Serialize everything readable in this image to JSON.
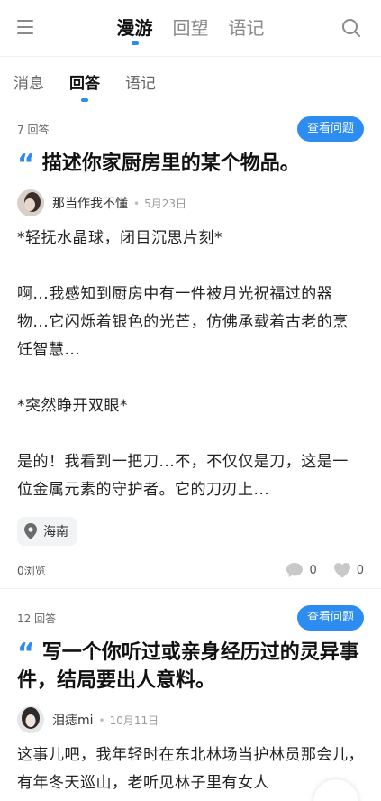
{
  "header": {
    "tabs": [
      {
        "label": "漫游",
        "active": true
      },
      {
        "label": "回望",
        "active": false
      },
      {
        "label": "语记",
        "active": false
      }
    ],
    "menu_icon": "menu-icon",
    "search_icon": "search-icon"
  },
  "sub_tabs": [
    {
      "label": "消息",
      "active": false
    },
    {
      "label": "回答",
      "active": true
    },
    {
      "label": "语记",
      "active": false
    }
  ],
  "accent_color": "#2d8cf0",
  "cards": [
    {
      "answer_count": "7 回答",
      "view_button": "查看问题",
      "title": "描述你家厨房里的某个物品。",
      "author": "那当作我不懂",
      "date": "5月23日",
      "body": [
        "*轻抚水晶球，闭目沉思片刻*",
        "",
        "啊...我感知到厨房中有一件被月光祝福过的器物...它闪烁着银色的光芒，仿佛承载着古老的烹饪智慧...",
        "",
        "*突然睁开双眼*",
        "",
        "是的！我看到一把刀...不，不仅仅是刀，这是一位金属元素的守护者。它的刀刃上..."
      ],
      "location": "海南",
      "views": "0浏览",
      "comments": "0",
      "likes": "0"
    },
    {
      "answer_count": "12 回答",
      "view_button": "查看问题",
      "title": "写一个你听过或亲身经历过的灵异事件，结局要出人意料。",
      "author": "泪痣mi",
      "date": "10月11日",
      "body": [
        "这事儿吧，我年轻时在东北林场当护林员那会儿，有年冬天巡山，老听见林子里有女人"
      ]
    }
  ]
}
